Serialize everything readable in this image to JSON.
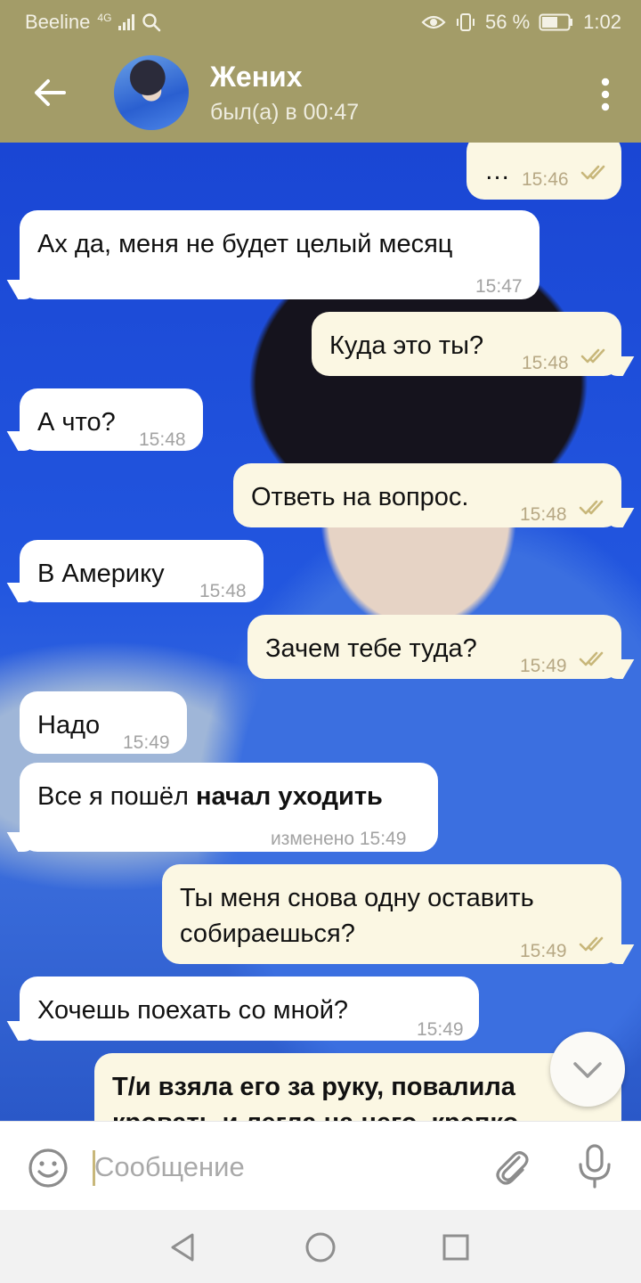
{
  "status_bar": {
    "carrier": "Beeline",
    "network": "4G",
    "battery": "56 %",
    "time": "1:02"
  },
  "header": {
    "title": "Жених",
    "last_seen": "был(а) в 00:47"
  },
  "messages": [
    {
      "dir": "out",
      "text": "…",
      "time": "15:46",
      "read": true
    },
    {
      "dir": "in",
      "text": "Ах да, меня не будет целый месяц",
      "time": "15:47"
    },
    {
      "dir": "out",
      "text": "Куда это ты?",
      "time": "15:48",
      "read": true
    },
    {
      "dir": "in",
      "text": "А что?",
      "time": "15:48"
    },
    {
      "dir": "out",
      "text": "Ответь на вопрос.",
      "time": "15:48",
      "read": true
    },
    {
      "dir": "in",
      "text": "В Америку",
      "time": "15:48"
    },
    {
      "dir": "out",
      "text": "Зачем тебе туда?",
      "time": "15:49",
      "read": true
    },
    {
      "dir": "in",
      "text": "Надо",
      "time": "15:49"
    },
    {
      "dir": "in",
      "text_plain": "Все я пошёл",
      "text_bold": "начал уходить",
      "time": "изменено 15:49"
    },
    {
      "dir": "out",
      "text_line1": "Ты меня снова одну оставить",
      "text_line2": "собираешься?",
      "time": "15:49",
      "read": true
    },
    {
      "dir": "in",
      "text": "Хочешь поехать со мной?",
      "time": "15:49"
    },
    {
      "dir": "out",
      "text_line1": "Т/и взяла его за руку, повалила",
      "text_line2": "кровать и легла на него, крепко"
    }
  ],
  "input": {
    "placeholder": "Сообщение"
  },
  "icons": {
    "back": "arrow-left-icon",
    "menu": "more-vert-icon",
    "scroll": "chevron-down-icon",
    "emoji": "smiley-icon",
    "attach": "paperclip-icon",
    "mic": "microphone-icon"
  },
  "colors": {
    "header": "#a39c68",
    "bubble_in": "#ffffff",
    "bubble_out": "#fbf7e3",
    "checkmark": "#c8b77a"
  }
}
